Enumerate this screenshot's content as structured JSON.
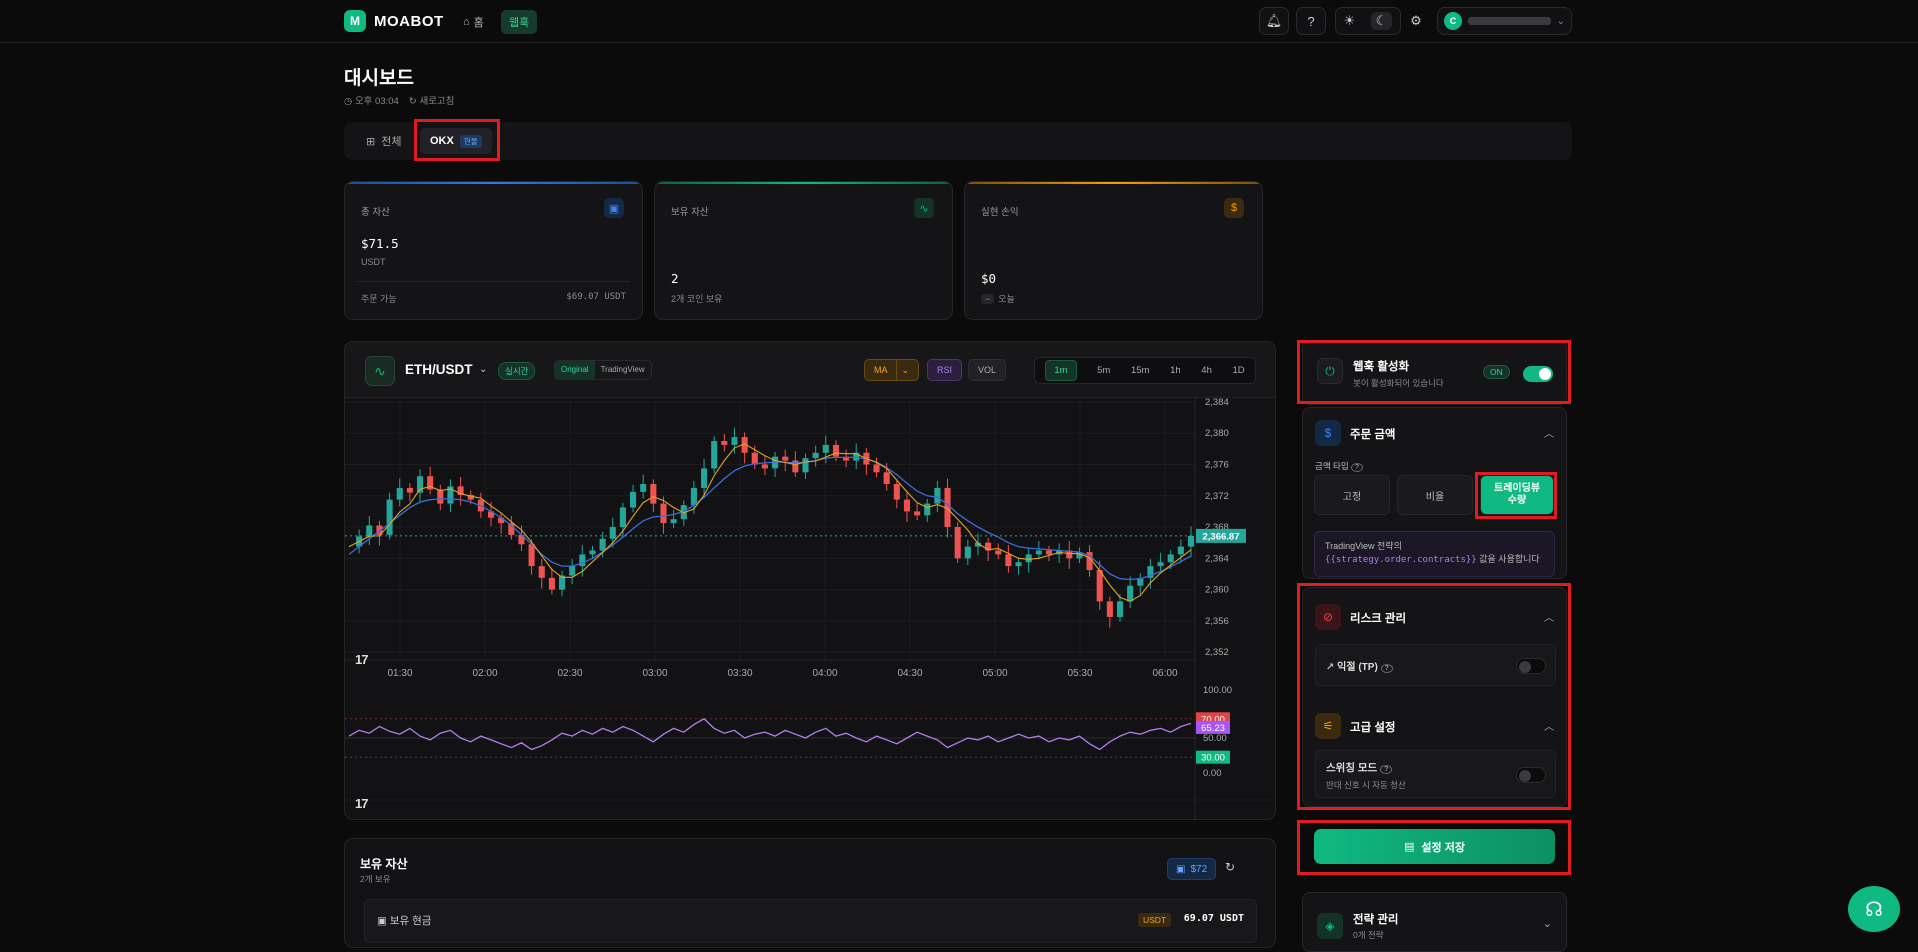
{
  "nav": {
    "brand_initial": "M",
    "brand": "MOABOT",
    "home": "홈",
    "webhook": "웹훅",
    "avatar_initial": "C"
  },
  "header": {
    "title": "대시보드",
    "time": "오후 03:04",
    "refresh": "새로고침"
  },
  "tabs": [
    {
      "label": "전체"
    },
    {
      "label": "OKX",
      "badge": "현물"
    }
  ],
  "stats": [
    {
      "label": "총 자산",
      "value": "$71.5",
      "sub": "USDT",
      "foot_left": "주문 가능",
      "foot_right": "$69.07 USDT",
      "icon": "wallet-icon",
      "color": "#3b82f6"
    },
    {
      "label": "보유 자산",
      "value": "2",
      "sub": "2개 코인 보유",
      "icon": "activity-icon",
      "color": "#10b981"
    },
    {
      "label": "실현 손익",
      "value": "$0",
      "sub": "오늘",
      "icon": "dollar-icon",
      "color": "#f59e0b"
    }
  ],
  "chart_header": {
    "pair": "ETH/USDT",
    "live": "실시간",
    "view_original": "Original",
    "view_tradingview": "TradingView",
    "ind_ma": "MA",
    "ind_rsi": "RSI",
    "ind_vol": "VOL",
    "timeframes": [
      "1m",
      "5m",
      "15m",
      "1h",
      "4h",
      "1D"
    ],
    "active_timeframe": "1m"
  },
  "chart_data": {
    "type": "line",
    "series": [
      {
        "name": "ETH/USDT",
        "values": [
          2365.5,
          2366.8,
          2368.2,
          2367.0,
          2371.5,
          2373.0,
          2372.4,
          2374.5,
          2372.8,
          2371.0,
          2373.2,
          2372.1,
          2371.5,
          2370.0,
          2369.2,
          2368.5,
          2367.0,
          2365.8,
          2363.0,
          2361.5,
          2360.0,
          2361.8,
          2363.0,
          2364.5,
          2365.0,
          2366.5,
          2368.0,
          2370.5,
          2372.5,
          2373.5,
          2371.0,
          2368.5,
          2369.0,
          2370.8,
          2373.0,
          2375.5,
          2379.0,
          2378.5,
          2379.5,
          2377.5,
          2376.0,
          2375.5,
          2377.0,
          2376.5,
          2375.0,
          2376.8,
          2377.5,
          2378.5,
          2377.0,
          2376.5,
          2377.5,
          2376.0,
          2375.0,
          2373.5,
          2371.5,
          2370.0,
          2369.5,
          2371.0,
          2373.0,
          2368.0,
          2364.0,
          2365.5,
          2366.0,
          2365.0,
          2364.5,
          2363.0,
          2363.5,
          2364.5,
          2365.0,
          2364.5,
          2365.0,
          2364.0,
          2364.8,
          2362.5,
          2358.5,
          2356.5,
          2358.5,
          2360.5,
          2361.5,
          2363.0,
          2363.5,
          2364.5,
          2365.5,
          2366.87
        ]
      },
      {
        "name": "MA",
        "values": [
          2364.5,
          2365.5,
          2366.5,
          2367.5,
          2368.5,
          2369.5,
          2370.5,
          2371.2,
          2371.5,
          2371.6,
          2371.6,
          2371.5,
          2371.2,
          2370.7,
          2370.0,
          2369.2,
          2368.2,
          2367.0,
          2365.8,
          2364.5,
          2363.5,
          2363.0,
          2363.0,
          2363.4,
          2364.0,
          2364.8,
          2365.7,
          2366.7,
          2367.8,
          2368.8,
          2369.3,
          2369.4,
          2369.6,
          2370.0,
          2370.8,
          2371.8,
          2373.0,
          2374.2,
          2375.2,
          2375.8,
          2376.1,
          2376.2,
          2376.3,
          2376.3,
          2376.2,
          2376.3,
          2376.5,
          2376.8,
          2376.9,
          2376.9,
          2376.9,
          2376.7,
          2376.3,
          2375.6,
          2374.7,
          2373.6,
          2372.6,
          2372.0,
          2371.8,
          2370.9,
          2369.7,
          2368.8,
          2368.0,
          2367.3,
          2366.7,
          2366.0,
          2365.5,
          2365.3,
          2365.2,
          2365.1,
          2365.0,
          2364.9,
          2364.8,
          2364.3,
          2363.2,
          2362.0,
          2361.4,
          2361.3,
          2361.4,
          2361.8,
          2362.3,
          2362.9,
          2363.6,
          2364.3
        ]
      },
      {
        "name": "RSI",
        "values": [
          52,
          58,
          55,
          62,
          57,
          54,
          60,
          52,
          48,
          55,
          58,
          50,
          46,
          52,
          48,
          44,
          40,
          45,
          38,
          42,
          48,
          55,
          52,
          58,
          54,
          60,
          56,
          62,
          58,
          52,
          46,
          54,
          60,
          56,
          64,
          70,
          60,
          55,
          58,
          50,
          54,
          56,
          52,
          58,
          54,
          50,
          56,
          60,
          52,
          55,
          50,
          46,
          52,
          48,
          44,
          50,
          56,
          52,
          48,
          40,
          45,
          50,
          48,
          52,
          46,
          50,
          54,
          50,
          52,
          46,
          50,
          48,
          52,
          44,
          38,
          46,
          52,
          56,
          54,
          58,
          60,
          56,
          62,
          65.23
        ]
      }
    ],
    "price_ticks": [
      "2,384",
      "2,380",
      "2,376",
      "2,372",
      "2,368",
      "2,364",
      "2,360",
      "2,356",
      "2,352"
    ],
    "time_ticks": [
      "01:30",
      "02:00",
      "02:30",
      "03:00",
      "03:30",
      "04:00",
      "04:30",
      "05:00",
      "05:30",
      "06:00"
    ],
    "rsi_ticks": [
      "100.00",
      "50.00",
      "0.00"
    ],
    "rsi_upper": "70.00",
    "rsi_lower": "30.00",
    "last_price": "2,366.87",
    "last_rsi": "65.23",
    "ylim": [
      2351,
      2384.5
    ],
    "rsi_ylim": [
      0,
      100
    ]
  },
  "right_panel": {
    "webhook_title": "웹훅 활성화",
    "webhook_sub": "봇이 활성화되어 있습니다",
    "webhook_state": "ON",
    "order_title": "주문 금액",
    "amount_type_label": "금액 타입",
    "opt_fixed": "고정",
    "opt_ratio": "비율",
    "opt_tv": "트레이딩뷰 수량",
    "tv_note_1": "TradingView 전략의",
    "tv_note_code": "{{strategy.order.contracts}}",
    "tv_note_2": "값을 사용합니다",
    "risk_title": "리스크 관리",
    "tp_label": "익절 (TP)",
    "adv_title": "고급 설정",
    "switch_label": "스위칭 모드",
    "switch_sub": "반대 신호 시 자동 청산",
    "save_label": "설정 저장",
    "strategy_title": "전략 관리",
    "strategy_sub": "0개 전략"
  },
  "holdings": {
    "title": "보유 자산",
    "sub": "2개 보유",
    "total": "$72",
    "cash_label": "보유 현금",
    "cash_currency": "USDT",
    "cash_value": "69.07 USDT"
  },
  "colors": {
    "accent": "#10b981",
    "up": "#26a69a",
    "down": "#ef5350",
    "ma_fast": "#e0a526",
    "ma_slow": "#3d6bd6",
    "rsi": "#b07ef0"
  }
}
